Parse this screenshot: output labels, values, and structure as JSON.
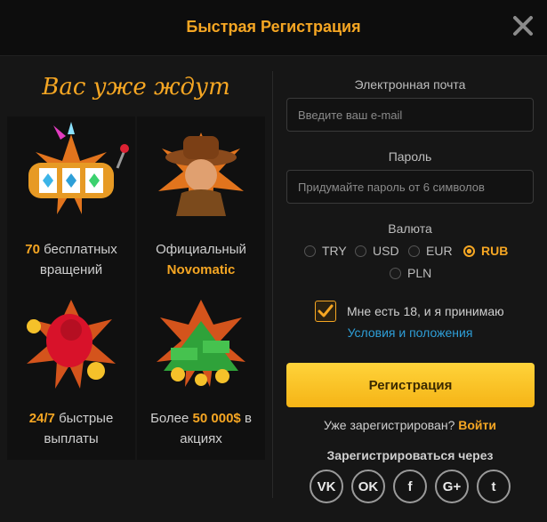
{
  "header": {
    "title": "Быстрая Регистрация",
    "close_icon": "close-icon"
  },
  "promo": {
    "heading": "Вас уже ждут",
    "tiles": [
      {
        "icon": "slot-machine-icon",
        "highlight": "70",
        "text": " бесплатных",
        "line2": "вращений"
      },
      {
        "icon": "novomatic-character-icon",
        "line1": "Официальный",
        "highlight": "Novomatic"
      },
      {
        "icon": "fire-character-icon",
        "highlight": "24/7",
        "text": " быстрые",
        "line2": "выплаты"
      },
      {
        "icon": "money-pile-icon",
        "prefix": "Более ",
        "highlight": "50 000$",
        "suffix": " в",
        "line2": "акциях"
      }
    ]
  },
  "form": {
    "email_label": "Электронная почта",
    "email_placeholder": "Введите ваш e-mail",
    "password_label": "Пароль",
    "password_placeholder": "Придумайте пароль от 6 символов",
    "currency_label": "Валюта",
    "currencies": [
      "TRY",
      "USD",
      "EUR",
      "RUB",
      "PLN"
    ],
    "selected_currency": "RUB",
    "age_checked": true,
    "terms_text": "Мне есть 18, и я принимаю",
    "terms_link": "Условия и положения",
    "register_button": "Регистрация",
    "already_text": "Уже зарегистрирован?",
    "login_link": "Войти",
    "social_label": "Зарегистрироваться через",
    "social": [
      {
        "name": "vk-icon",
        "glyph": "VK"
      },
      {
        "name": "odnoklassniki-icon",
        "glyph": "OK"
      },
      {
        "name": "facebook-icon",
        "glyph": "f"
      },
      {
        "name": "google-plus-icon",
        "glyph": "G+"
      },
      {
        "name": "twitter-icon",
        "glyph": "t"
      }
    ]
  },
  "colors": {
    "accent": "#f5a623",
    "link": "#2e9fd8",
    "background": "#161616"
  }
}
